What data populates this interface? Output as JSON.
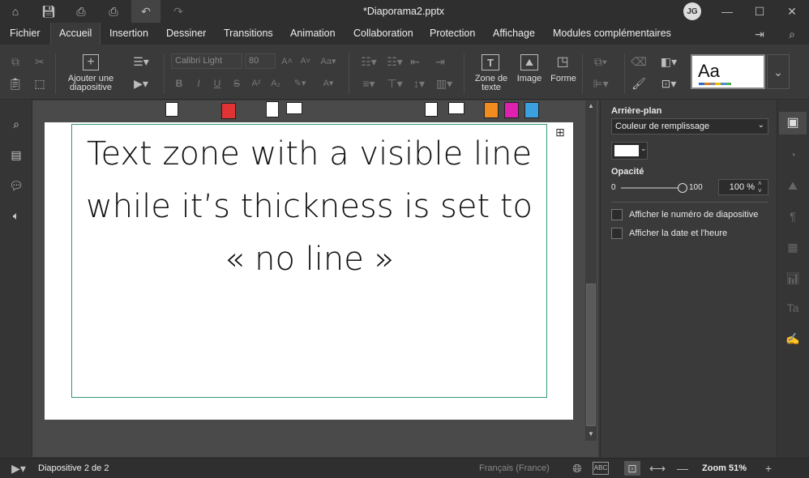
{
  "window": {
    "title": "*Diaporama2.pptx",
    "user_initials": "JG"
  },
  "tabs": [
    "Fichier",
    "Accueil",
    "Insertion",
    "Dessiner",
    "Transitions",
    "Animation",
    "Collaboration",
    "Protection",
    "Affichage",
    "Modules complémentaires"
  ],
  "active_tab": "Accueil",
  "ribbon": {
    "add_slide_line1": "Ajouter une",
    "add_slide_line2": "diapositive",
    "font_name": "Calibri Light",
    "font_size": "80",
    "textbox_line1": "Zone de",
    "textbox_line2": "texte",
    "image_label": "Image",
    "shape_label": "Forme",
    "style_preview": "Aa",
    "bold": "B",
    "italic": "I",
    "underline": "U",
    "strike": "S"
  },
  "slide": {
    "text": "Text zone with a visible line while it’s thickness is set to « no line »"
  },
  "panel": {
    "background_label": "Arrière-plan",
    "fill_type": "Couleur de remplissage",
    "opacity_label": "Opacité",
    "opacity_min": "0",
    "opacity_max": "100",
    "opacity_value": "100 %",
    "opacity_level": 1.0,
    "show_slide_number": "Afficher le numéro de diapositive",
    "show_date_time": "Afficher la date et l'heure"
  },
  "status": {
    "slide_info": "Diapositive 2 de 2",
    "language": "Français (France)",
    "zoom": "Zoom 51%"
  },
  "colors": {
    "accent_green": "#2e9a6e",
    "tab_bg": "#2f2f2f",
    "ribbon_bg": "#3a3a3a"
  }
}
